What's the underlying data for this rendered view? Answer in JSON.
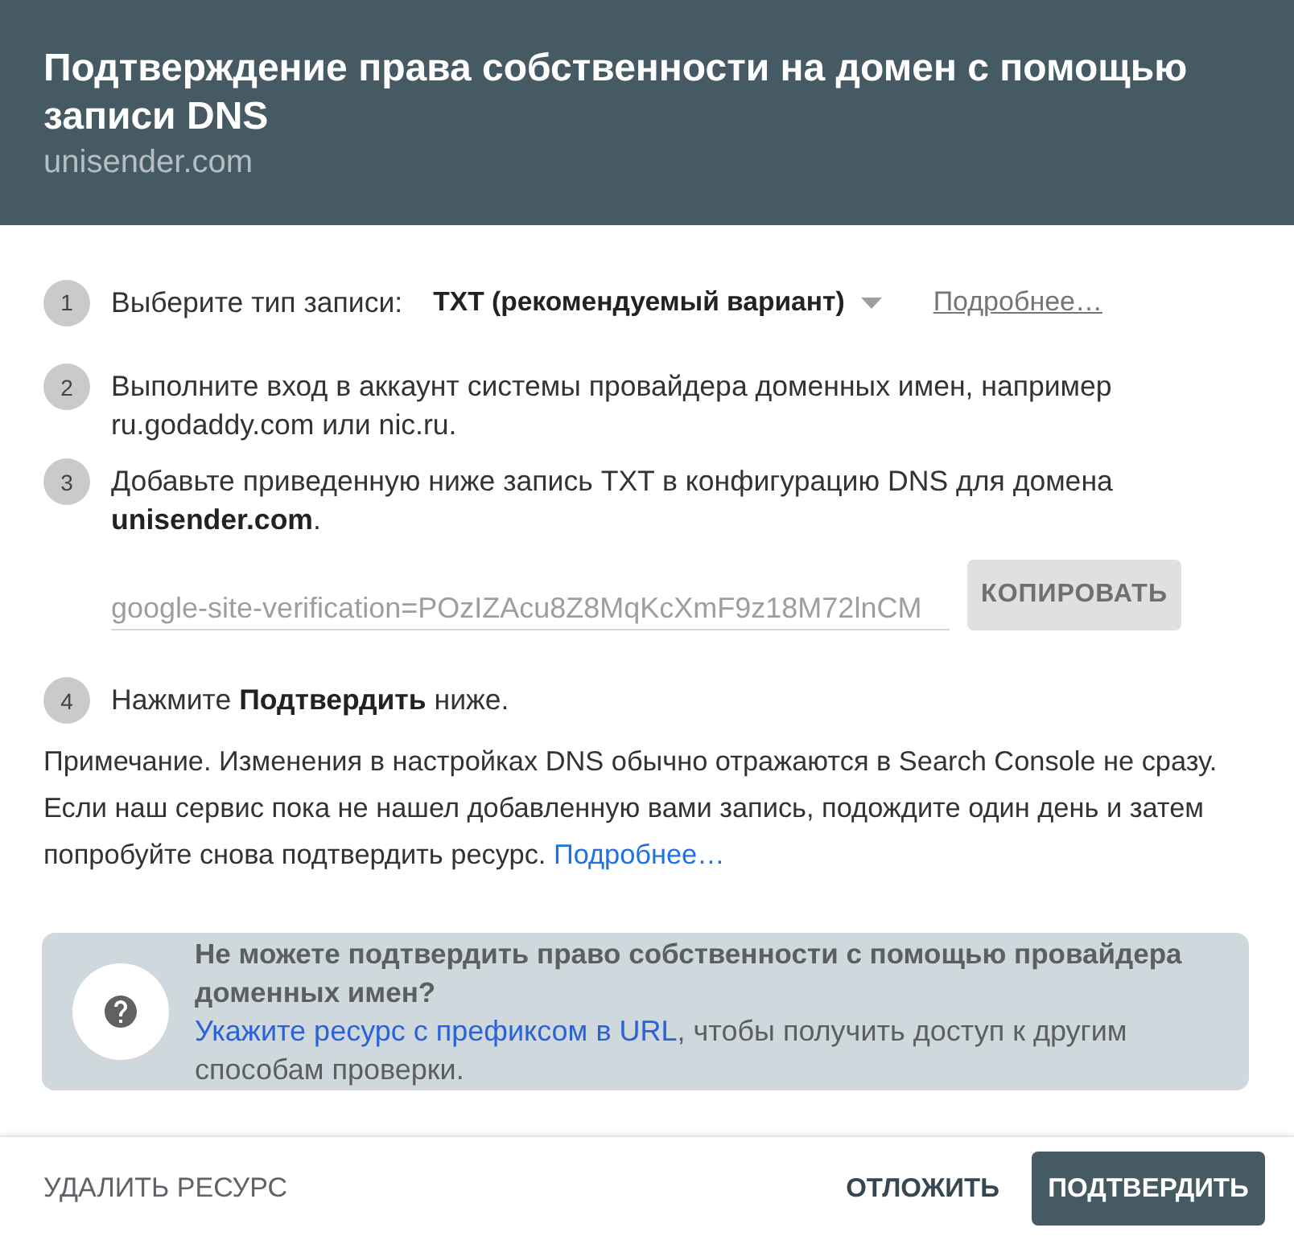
{
  "dialog": {
    "title": "Подтверждение права собственности на домен с помощью записи DNS",
    "subtitle": "unisender.com"
  },
  "steps": [
    {
      "number": "1",
      "kind": "select",
      "label": "Выберите тип записи:",
      "value": "TXT (рекомендуемый вариант)",
      "link": "Подробнее…"
    },
    {
      "number": "2",
      "kind": "text",
      "text": "Выполните вход в аккаунт системы провайдера доменных имен, например ru.godaddy.com или nic.ru."
    },
    {
      "number": "3",
      "kind": "record",
      "text": "Добавьте приведенную ниже запись TXT в конфигурацию DNS для домена **unisender.com**.",
      "record": "google-site-verification=POzIZAcu8Z8MqKcXmF9z18M72lnCM",
      "button": "КОПИРОВАТЬ"
    },
    {
      "number": "4",
      "kind": "text",
      "text": "Нажмите **Подтвердить** ниже."
    }
  ],
  "note": {
    "text": "Примечание. Изменения в настройках DNS обычно отражаются в Search Console не сразу. Если наш сервис пока не нашел добавленную вами запись, подождите один день и затем попробуйте снова подтвердить ресурс.",
    "link": "Подробнее…"
  },
  "help_card": {
    "title": "Не можете подтвердить право собственности с помощью провайдера доменных имен?",
    "link": "Укажите ресурс с префиксом в URL",
    "text": ", чтобы получить доступ к другим способам проверки."
  },
  "footer": {
    "delete": "УДАЛИТЬ РЕСУРС",
    "postpone": "ОТЛОЖИТЬ",
    "confirm": "ПОДТВЕРДИТЬ"
  }
}
